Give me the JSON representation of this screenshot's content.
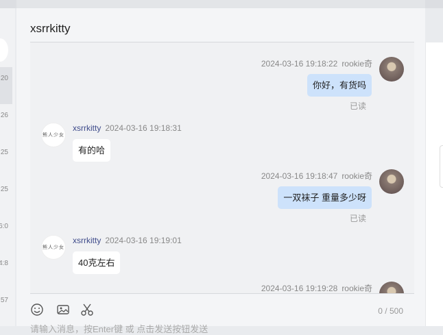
{
  "chat": {
    "title": "xsrrkitty",
    "char_count": "0 / 500",
    "input_placeholder": "请输入消息，按Enter键 或 点击发送按钮发送"
  },
  "left_list": {
    "times": [
      "20",
      "26",
      "25",
      "25",
      "6:0",
      "4:8",
      "57"
    ]
  },
  "messages": [
    {
      "side": "self",
      "time": "2024-03-16 19:18:22",
      "name": "rookie奇",
      "text": "你好，有货吗",
      "status": "已读"
    },
    {
      "side": "other",
      "name": "xsrrkitty",
      "time": "2024-03-16 19:18:31",
      "text": "有的哈",
      "avatar_text": "熊人少女"
    },
    {
      "side": "self",
      "time": "2024-03-16 19:18:47",
      "name": "rookie奇",
      "text": "一双袜子 重量多少呀",
      "status": "已读"
    },
    {
      "side": "other",
      "name": "xsrrkitty",
      "time": "2024-03-16 19:19:01",
      "text": "40克左右",
      "avatar_text": "熊人少女"
    },
    {
      "side": "self",
      "time": "2024-03-16 19:19:28",
      "name": "rookie奇"
    }
  ],
  "tools": [
    "emoji-icon",
    "image-icon",
    "scissors-icon"
  ],
  "colors": {
    "self_bubble": "#cde2fb",
    "other_bubble": "#ffffff",
    "name_link": "#3d4a8a"
  }
}
